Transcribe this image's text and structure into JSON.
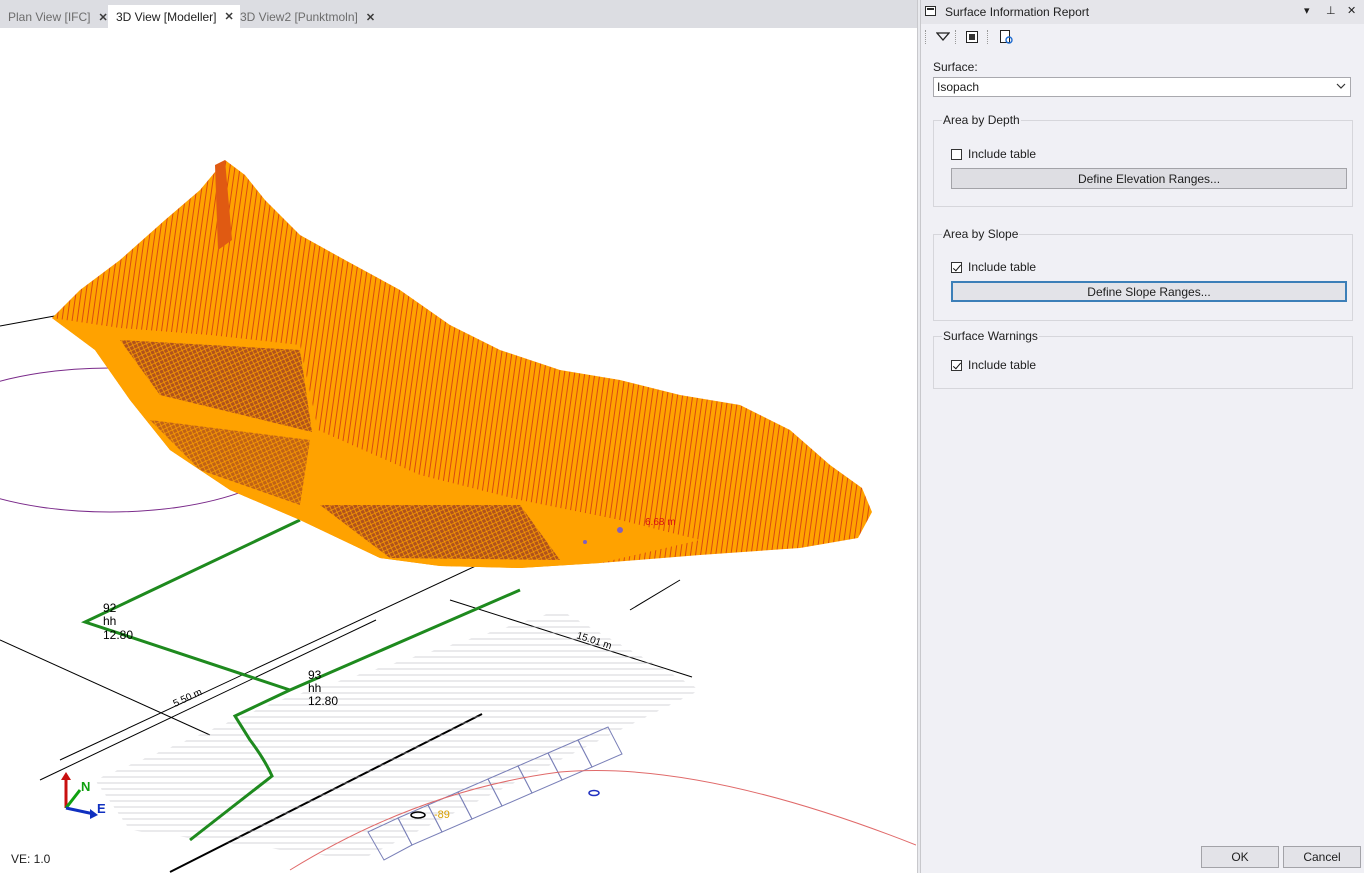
{
  "tabs": [
    {
      "label": "Plan View [IFC]",
      "close": "✕"
    },
    {
      "label": "3D View [Modeller]",
      "close": "✕"
    },
    {
      "label": "3D View2 [Punktmoln]",
      "close": "✕"
    }
  ],
  "viewport": {
    "ve_label": "VE: 1.0",
    "annotations": {
      "a1": "92",
      "a2": "hh",
      "a3": "12.80",
      "b1": "93",
      "b2": "hh",
      "b3": "12.80",
      "dim1": "5.50 m",
      "dim2": "15.01 m",
      "dim3": "6.68 m",
      "dim4": "-89"
    },
    "axis": {
      "north": "N",
      "east": "E"
    },
    "colors": {
      "surface": "#ffa200",
      "surface_dark": "#e05a12",
      "line_green": "#1e8a1e",
      "purple": "#7a2a8a",
      "red_line": "#e06a6a",
      "hatch": "#9aa0c8"
    }
  },
  "panel": {
    "title": "Surface Information Report",
    "controls": {
      "menu": "▾",
      "pin": "⊥",
      "close": "✕"
    },
    "toolbar": [
      "filter-icon",
      "report-icon",
      "preview-icon"
    ],
    "surface_label": "Surface:",
    "surface_value": "Isopach",
    "groups": {
      "depth": {
        "legend": "Area by Depth",
        "include_label": "Include table",
        "checked": false,
        "button": "Define Elevation Ranges..."
      },
      "slope": {
        "legend": "Area by Slope",
        "include_label": "Include table",
        "checked": true,
        "button": "Define Slope Ranges..."
      },
      "warnings": {
        "legend": "Surface Warnings",
        "include_label": "Include table",
        "checked": true
      }
    },
    "ok_label": "OK",
    "cancel_label": "Cancel"
  }
}
